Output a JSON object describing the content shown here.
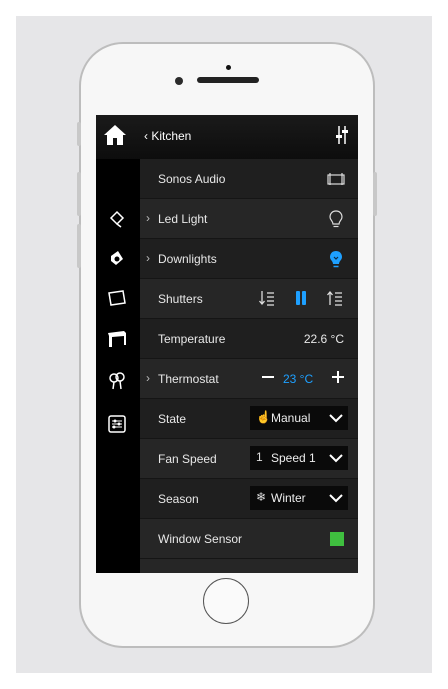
{
  "header": {
    "back_title": "‹ Kitchen"
  },
  "rows": [
    {
      "label": "Sonos Audio"
    },
    {
      "label": "Led Light",
      "chevron": "›"
    },
    {
      "label": "Downlights",
      "chevron": "›"
    },
    {
      "label": "Shutters"
    },
    {
      "label": "Temperature",
      "value": "22.6 °C"
    },
    {
      "label": "Thermostat",
      "chevron": "›",
      "setpoint": "23 °C",
      "minus": "−",
      "plus": "+"
    },
    {
      "label": "State",
      "selected": "Manual",
      "icon_glyph": "☝"
    },
    {
      "label": "Fan Speed",
      "selected": "Speed 1",
      "icon_glyph": "1"
    },
    {
      "label": "Season",
      "selected": "Winter",
      "icon_glyph": "❄"
    },
    {
      "label": "Window Sensor",
      "status": "on"
    }
  ],
  "colors": {
    "accent": "#1ea0ff",
    "sensor_on": "#3fbf3f",
    "background": "#e6e6e8"
  },
  "icons": {
    "home": "home-icon",
    "tools": "settings-sliders-icon",
    "sidebar": [
      "lamp-icon",
      "speaker-icon",
      "window-icon",
      "table-icon",
      "tree-icon",
      "control-panel-icon"
    ],
    "sonos": "speaker-dock-icon",
    "led": "lightbulb-outline-icon",
    "downlights": "lightbulb-active-icon",
    "shutters": [
      "shutter-down-icon",
      "shutter-stop-icon",
      "shutter-up-icon"
    ]
  }
}
